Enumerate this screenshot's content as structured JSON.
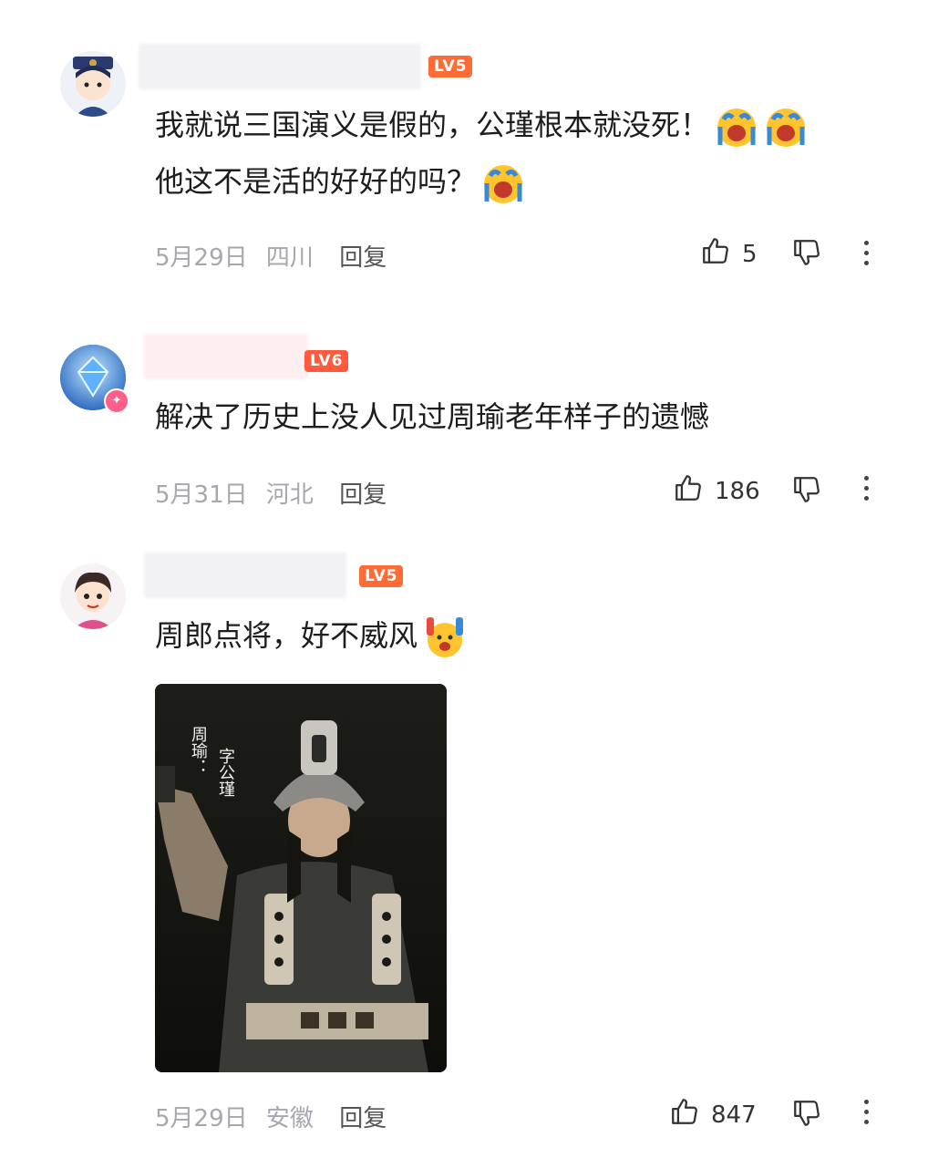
{
  "comments": [
    {
      "level": "LV5",
      "level_color": "#ff6b35",
      "lines": [
        "我就说三国演义是假的，公瑾根本就没死！",
        "他这不是活的好好的吗？"
      ],
      "date": "5月29日",
      "location": "四川",
      "reply_label": "回复",
      "likes": "5"
    },
    {
      "level": "LV6",
      "level_color": "#ff5a3c",
      "lines": [
        "解决了历史上没人见过周瑜老年样子的遗憾"
      ],
      "date": "5月31日",
      "location": "河北",
      "reply_label": "回复",
      "likes": "186"
    },
    {
      "level": "LV5",
      "level_color": "#ff6b35",
      "lines": [
        "周郎点将，好不威风"
      ],
      "image_caption": [
        "周瑜：",
        "字公瑾"
      ],
      "date": "5月29日",
      "location": "安徽",
      "reply_label": "回复",
      "likes": "847"
    }
  ],
  "icons": {
    "like": "thumbs-up-icon",
    "dislike": "thumbs-down-icon",
    "more": "more-vertical-icon",
    "emoji_cry": "crying-face-icon",
    "emoji_cheer": "cheering-face-icon"
  }
}
